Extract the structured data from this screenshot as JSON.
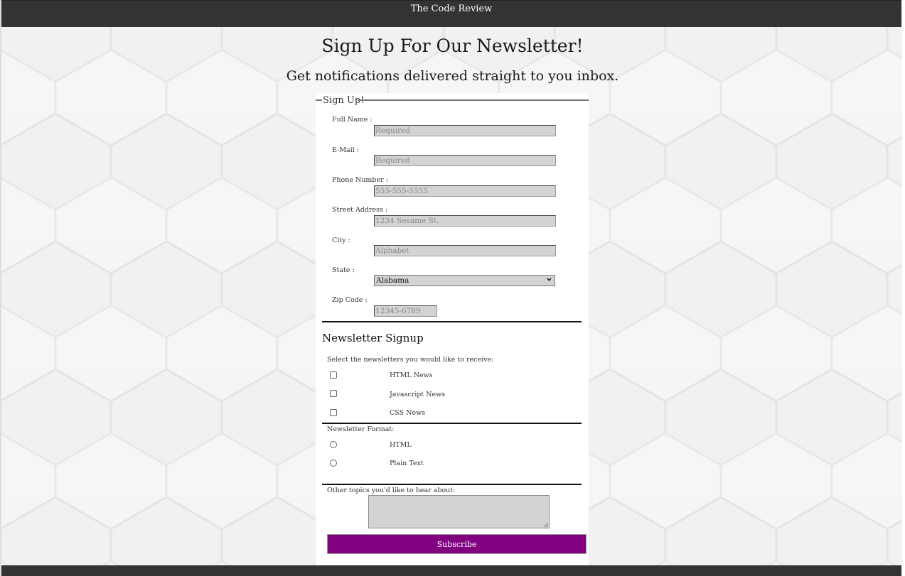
{
  "header": {
    "site_title": "The Code Review"
  },
  "hero": {
    "title": "Sign Up For Our Newsletter!",
    "subtitle": "Get notifications delivered straight to you inbox."
  },
  "form": {
    "legend": "Sign Up!",
    "fields": {
      "full_name": {
        "label": "Full Name :",
        "placeholder": "Required"
      },
      "email": {
        "label": "E-Mail :",
        "placeholder": "Required"
      },
      "phone": {
        "label": "Phone Number :",
        "placeholder": "555-555-5555"
      },
      "street": {
        "label": "Street Address :",
        "placeholder": "1234 Sesame St."
      },
      "city": {
        "label": "City :",
        "placeholder": "Alphabet"
      },
      "state": {
        "label": "State :",
        "selected": "Alabama"
      },
      "zip": {
        "label": "Zip Code :",
        "placeholder": "12345-6789"
      }
    },
    "newsletter": {
      "title": "Newsletter Signup",
      "select_hint": "Select the newsletters you would like to receive:",
      "options": [
        "HTML News",
        "Javascript News",
        "CSS News"
      ],
      "format_label": "Newsletter Format:",
      "formats": [
        "HTML",
        "Plain Text"
      ],
      "topics_label": "Other topics you'd like to hear about:"
    },
    "submit_label": "Subscribe"
  },
  "colors": {
    "header_bg": "#333333",
    "button_bg": "#800080",
    "input_bg": "#d3d3d3"
  },
  "icons": [
    "chevron-down-icon",
    "resize-grip-icon"
  ]
}
